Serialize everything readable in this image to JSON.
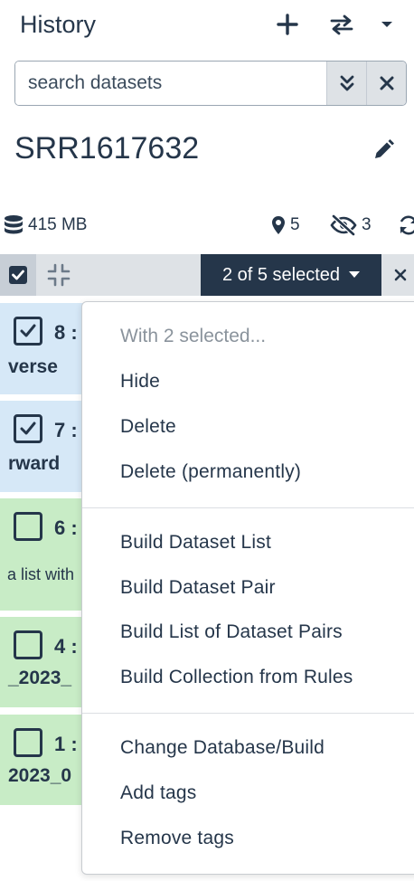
{
  "panel": {
    "title": "History"
  },
  "search": {
    "placeholder": "search datasets"
  },
  "history": {
    "name": "SRR1617632"
  },
  "stats": {
    "size": "415 MB",
    "shown_count": "5",
    "hidden_count": "3"
  },
  "selection": {
    "label": "2 of 5 selected"
  },
  "items": [
    {
      "num": "8 :",
      "name": "verse",
      "desc": "",
      "checked": true,
      "state": "blue"
    },
    {
      "num": "7 :",
      "name": "rward",
      "desc": "",
      "checked": true,
      "state": "blue"
    },
    {
      "num": "6 :",
      "name": "",
      "desc": "a list with",
      "checked": false,
      "state": "green"
    },
    {
      "num": "4 :",
      "name": "_2023_",
      "desc": "",
      "checked": false,
      "state": "green"
    },
    {
      "num": "1 :",
      "name": "2023_0",
      "desc": "",
      "checked": false,
      "state": "green"
    }
  ],
  "menu": {
    "header": "With 2 selected...",
    "items": [
      "Hide",
      "Delete",
      "Delete (permanently)",
      "Build Dataset List",
      "Build Dataset Pair",
      "Build List of Dataset Pairs",
      "Build Collection from Rules",
      "Change Database/Build",
      "Add tags",
      "Remove tags"
    ]
  },
  "colors": {
    "primary": "#25364a",
    "selected_row": "#d6e8f7",
    "ok_row": "#c8ecc6",
    "toolbar_bg": "#dee2e6"
  },
  "icons": {
    "new_history": "plus-icon",
    "switch_history": "exchange-icon",
    "options": "caret-down-icon",
    "advanced_search": "double-chevron-down-icon",
    "clear_search": "close-icon",
    "edit": "pencil-icon",
    "size": "database-icon",
    "shown": "map-marker-icon",
    "hidden": "eye-slash-icon",
    "refresh": "refresh-icon",
    "select_all": "checked-checkbox-icon",
    "collapse": "compress-icon"
  }
}
